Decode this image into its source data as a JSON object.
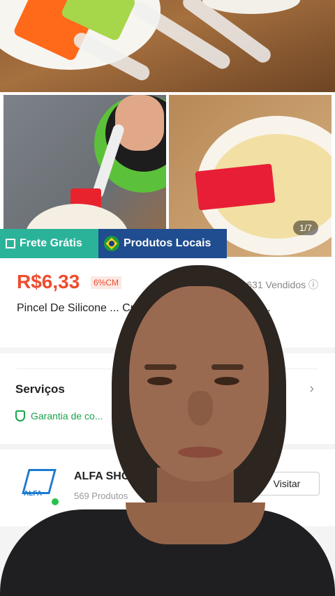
{
  "product": {
    "image_counter": "1/7",
    "tags": {
      "free_shipping": "Frete Grátis",
      "local": "Produtos Locais"
    },
    "price": "R$6,33",
    "discount_badge": "6%CM",
    "sold": "631 Vendidos",
    "title": "Pincel De Silicone ... Creme De Óleo Para Cozim..."
  },
  "services": {
    "label": "Serviços",
    "guarantee": "Garantia de co..."
  },
  "shop": {
    "name": "ALFA SHOP.",
    "products": "569 Produtos",
    "visit_label": "Visitar",
    "logo_text": "ALFA"
  },
  "colors": {
    "price": "#ee4d2d",
    "free_shipping_tag": "#2bb39a",
    "local_tag": "#1f4d8f",
    "guarantee": "#1aa34a"
  }
}
